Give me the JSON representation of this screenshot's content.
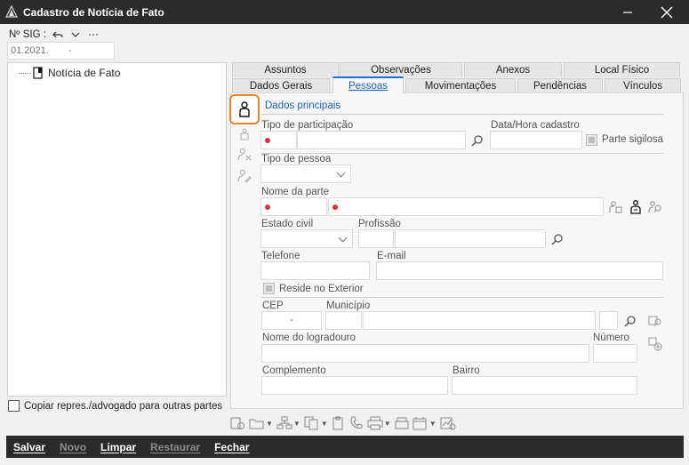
{
  "window": {
    "title": "Cadastro de Notícia de Fato"
  },
  "sig": {
    "label": "Nº SIG :",
    "value_prefix": "01.2021.",
    "value_sep": "-"
  },
  "tree": {
    "items": [
      {
        "label": "Notícia de Fato"
      }
    ]
  },
  "copy_option": {
    "label": "Copiar repres./advogado para outras partes",
    "checked": false
  },
  "tabs_row1": [
    "Assuntos",
    "Observações",
    "Anexos",
    "Local Físico"
  ],
  "tabs_row2": [
    "Dados Gerais",
    "Pessoas",
    "Movimentações",
    "Pendências",
    "Vínculos"
  ],
  "active_tab": "Pessoas",
  "sub_tab": "Dados principais",
  "form": {
    "tipo_participacao": "Tipo de participação",
    "data_hora": "Data/Hora cadastro",
    "parte_sigilosa": "Parte sigilosa",
    "tipo_pessoa": "Tipo de pessoa",
    "nome_parte": "Nome da parte",
    "estado_civil": "Estado civil",
    "profissao": "Profissão",
    "telefone": "Telefone",
    "email": "E-mail",
    "reside_exterior": "Reside no Exterior",
    "cep": "CEP",
    "cep_value": "-",
    "municipio": "Município",
    "logradouro": "Nome do logradouro",
    "numero": "Número",
    "complemento": "Complemento",
    "bairro": "Bairro"
  },
  "actions": [
    {
      "label": "Salvar",
      "enabled": true
    },
    {
      "label": "Novo",
      "enabled": false
    },
    {
      "label": "Limpar",
      "enabled": true
    },
    {
      "label": "Restaurar",
      "enabled": false
    },
    {
      "label": "Fechar",
      "enabled": true
    }
  ],
  "colors": {
    "titlebar": "#2b2b2b",
    "accent": "#1565c0",
    "highlight": "#e8832a",
    "required": "#e03030"
  }
}
